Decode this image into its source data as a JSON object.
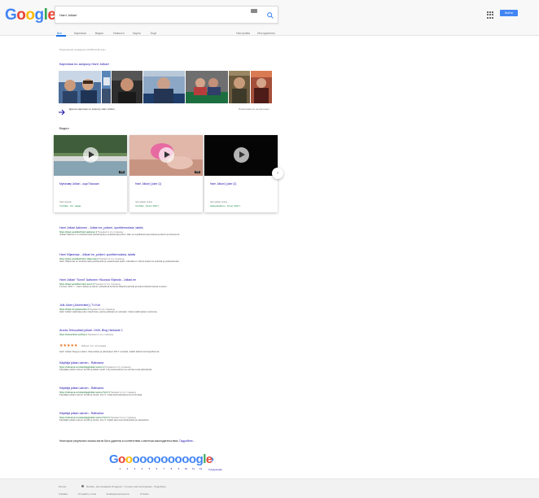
{
  "header": {
    "logo_letters": [
      {
        "ch": "G",
        "color": "#4285f4"
      },
      {
        "ch": "o",
        "color": "#ea4335"
      },
      {
        "ch": "o",
        "color": "#fbbc05"
      },
      {
        "ch": "g",
        "color": "#4285f4"
      },
      {
        "ch": "l",
        "color": "#34a853"
      },
      {
        "ch": "e",
        "color": "#ea4335"
      }
    ],
    "query": "Harri Jolkari",
    "signin_label": "Войти"
  },
  "tabs": [
    "Все",
    "Картинки",
    "Видео",
    "Новости",
    "Карты",
    "Ещё",
    "Настройки",
    "Инструменты"
  ],
  "stats": "Результатов: примерно 10 500 (0,46 сек.)",
  "images": {
    "title": "Картинки по запросу Harri Jolkari",
    "more_label": "Другие картинки по запросу Harri Jolkari",
    "feedback": "Пожаловаться на картинки"
  },
  "videos": {
    "title": "Видео",
    "items": [
      {
        "title": "Мунахаву Jolkari - ощи Пассаан",
        "duration": "4:00",
        "source": "Harri Ayaran",
        "meta": "YouTube · 21 г. назад"
      },
      {
        "title": "Harri Jolkari | joker (1)",
        "duration": "3:00",
        "source": "harri jolkari online",
        "meta": "YouTube · 16 окт. 2017 г."
      },
      {
        "title": "Harri Jolkari | joker (2)",
        "duration": "",
        "source": "harri jolkari online",
        "meta": "www.peredel.ru · 16 окт. 2017 г."
      }
    ]
  },
  "results": [
    {
      "title": "Harri Jolkari Aalionen - Jolkari ee_poikeri, sportitermuksia, taistis",
      "url": "https://joker.ee/jolkari/harri-aalionen",
      "translate": "Перевести эту страницу",
      "snippet": "Jolkari Aalionen on ehdottomasti parhaimpia ja osaavampia peluri. Hän on lopullisesti panostaneet jokeriin ja sitoutunut."
    },
    {
      "title": "Harri Viljanmaa - Jolkari ee_poikeri, sportitermuksia, taistis",
      "url": "https://joker.ee/jolkari/harri-viljanmaa",
      "translate": "Перевести эту страницу",
      "snippet": "Harri Viljanmaa on ehdottomasti parhaimpia ja osaavampia peluri. Hänellä on vahva kokemus peleistä ja pelaamisesta."
    },
    {
      "title": "Harri Jolkari \"Sonni\" Aaltonen «Suossa Viljanda - Jolkari.ee",
      "url": "https://joker.ee/jolkari-harri-sonni",
      "translate": "Перевести эту страницу",
      "snippet": "11 июн. 2017 г. - Harri Jolkari ja hänen ystävänsä kertovat Viljandi peleistä ja kokemuksista kautta vuosien."
    },
    {
      "title": "Jolk Joker (Jokeriviste) | Tv Kar",
      "url": "https://tvkar.com/jokeriviste",
      "translate": "Перевести эту страницу",
      "snippet": "Harri Jolkari vaikuttaa joker ohjelmissa, joissa pelataan ja voitetaan. Katso kaikki jaksot verkossa."
    },
    {
      "title": "Arvuta Teleuudiset jolkari: 1949, Blog Harbaute 1",
      "url": "https://teleuudiset.ee/blog",
      "translate": "Перевести эту страницу",
      "stars": "★★★★★",
      "stars_text": "Рейтинг: 5,0 - 10 отзывов",
      "snippet": "Harri Jolkari blogi ja uutiset. Teleuudiset ja päivitykset 2017 vuodelta, kaikki tärkeimmät tapahtumat."
    },
    {
      "title": "Käyttäjä jolkari-varnen - Rattvama",
      "url": "https://rattvama.com/kayttaja/jolkari-varnen",
      "translate": "Перевести эту страницу",
      "snippet": "Käyttäjän jolkari-varnen profiili ja kaikki viestit. Liity keskusteluun ja seuraa uusia päivityksiä."
    },
    {
      "title": "Käyttäjä jolkari-varnen - Rattvama",
      "url": "https://rattvama.com/kayttaja/jolkari-varnen?p=2",
      "translate": "Перевести эту страницу",
      "snippet": "Käyttäjän jolkari-varnen profiili ja viestit, sivu 2. Lisää keskusteluja ja kommentteja."
    },
    {
      "title": "Käyttäjä jolkari-varnen - Rattvama",
      "url": "https://rattvama.com/kayttaja/jolkari-varnen?p=3",
      "translate": "Перевести эту страницу",
      "snippet": "Käyttäjän jolkari-varnen profiili ja viestit, sivu 3. Kaikki aiemmat keskustelut ja vastaukset."
    }
  ],
  "removed_notice": "Некоторые результаты поиска могли быть удалены в соответствии с местным законодательством.",
  "removed_link": "Подробнее...",
  "pager": {
    "letters": [
      {
        "ch": "G",
        "color": "#4285f4"
      },
      {
        "ch": "o",
        "color": "#ea4335"
      },
      {
        "ch": "o",
        "color": "#fbbc05"
      },
      {
        "ch": "o",
        "color": "#4285f4"
      },
      {
        "ch": "o",
        "color": "#4285f4"
      },
      {
        "ch": "o",
        "color": "#4285f4"
      },
      {
        "ch": "o",
        "color": "#4285f4"
      },
      {
        "ch": "o",
        "color": "#4285f4"
      },
      {
        "ch": "o",
        "color": "#4285f4"
      },
      {
        "ch": "o",
        "color": "#4285f4"
      },
      {
        "ch": "o",
        "color": "#4285f4"
      },
      {
        "ch": "o",
        "color": "#4285f4"
      },
      {
        "ch": "g",
        "color": "#4285f4"
      },
      {
        "ch": "l",
        "color": "#34a853"
      },
      {
        "ch": "e",
        "color": "#ea4335"
      }
    ],
    "numbers": [
      "1",
      "2",
      "3",
      "4",
      "5",
      "6",
      "7",
      "8",
      "9",
      "10",
      "11",
      "12"
    ],
    "next_label": "Следующая"
  },
  "footer": {
    "country": "Россия",
    "location": "Москва - На основании IP-адреса - Уточнить местоположение - Подробнее",
    "links": [
      "Справка",
      "Отправить отзыв",
      "Конфиденциальность",
      "Условия"
    ]
  }
}
